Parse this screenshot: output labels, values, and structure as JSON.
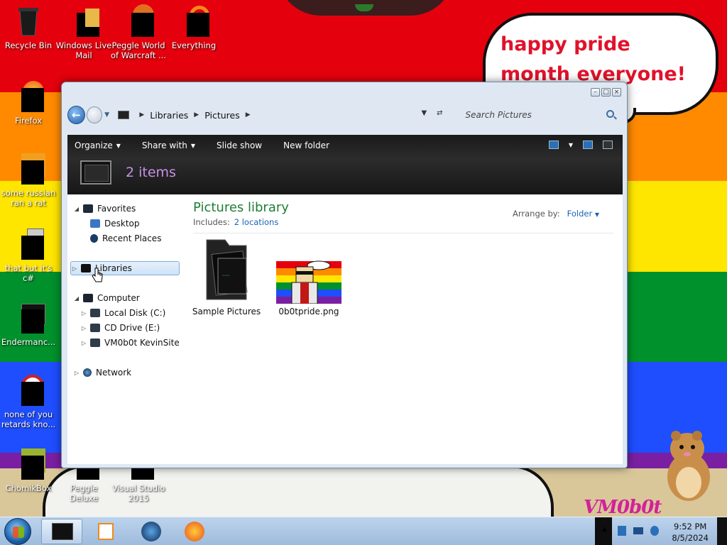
{
  "desktop": {
    "speech_bubble": "happy pride month everyone!",
    "watermark": "VM0b0t",
    "icons": [
      {
        "label": "Recycle Bin"
      },
      {
        "label": "Windows Live Mail"
      },
      {
        "label": "Peggle World of Warcraft ..."
      },
      {
        "label": "Everything"
      },
      {
        "label": "Firefox"
      },
      {
        "label": "some russian ran a rat"
      },
      {
        "label": "that but it's c#"
      },
      {
        "label": "Endermanc..."
      },
      {
        "label": "none of you retards kno..."
      },
      {
        "label": "ChomikBox"
      },
      {
        "label": "Peggle Deluxe"
      },
      {
        "label": "Visual Studio 2015"
      }
    ]
  },
  "explorer": {
    "breadcrumbs": [
      "Libraries",
      "Pictures"
    ],
    "search_placeholder": "Search Pictures",
    "commands": [
      {
        "label": "Organize",
        "dropdown": true
      },
      {
        "label": "Share with",
        "dropdown": true
      },
      {
        "label": "Slide show",
        "dropdown": false
      },
      {
        "label": "New folder",
        "dropdown": false
      }
    ],
    "items_count": "2 items",
    "nav": {
      "favorites": "Favorites",
      "desktop": "Desktop",
      "recent_places": "Recent Places",
      "libraries": "Libraries",
      "computer": "Computer",
      "local_disk": "Local Disk (C:)",
      "cd_drive": "CD Drive (E:)",
      "kevinsite": "VM0b0t KevinSite",
      "network": "Network"
    },
    "library_title": "Pictures library",
    "includes_label": "Includes:",
    "includes_link": "2 locations",
    "arrange_label": "Arrange by:",
    "arrange_value": "Folder",
    "files": [
      {
        "name": "Sample Pictures",
        "type": "folder"
      },
      {
        "name": "0b0tpride.png",
        "type": "image"
      }
    ]
  },
  "taskbar": {
    "time": "9:52 PM",
    "date": "8/5/2024"
  }
}
